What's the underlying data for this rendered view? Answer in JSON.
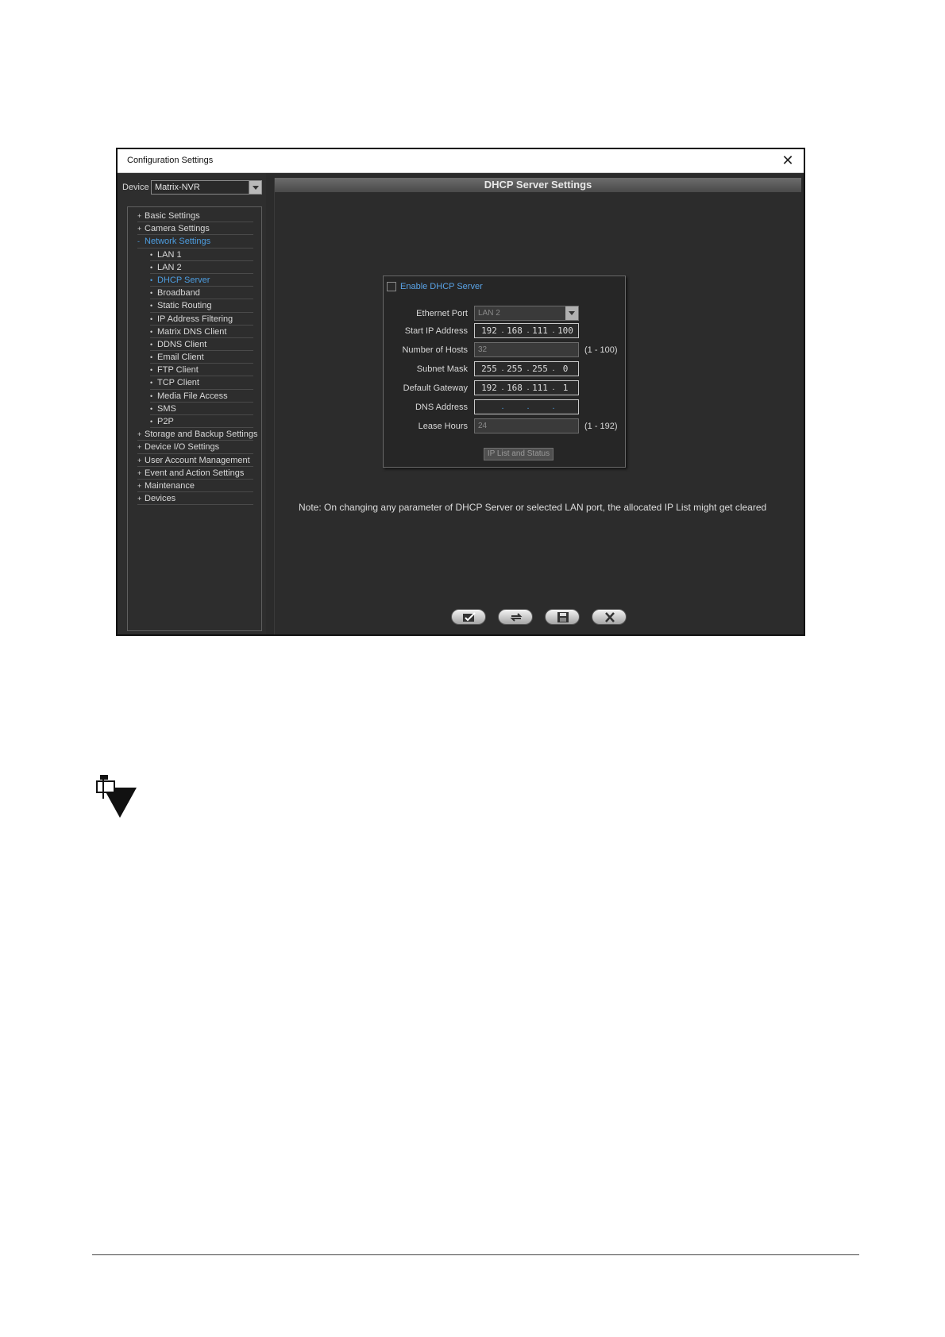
{
  "window": {
    "title": "Configuration Settings"
  },
  "device": {
    "label": "Device",
    "value": "Matrix-NVR"
  },
  "tree": {
    "items": [
      {
        "label": "Basic Settings",
        "mark": "+",
        "level": 0,
        "active": false
      },
      {
        "label": "Camera Settings",
        "mark": "+",
        "level": 0,
        "active": false
      },
      {
        "label": "Network Settings",
        "mark": "-",
        "level": 0,
        "active": true
      },
      {
        "label": "LAN 1",
        "mark": "•",
        "level": 1,
        "active": false
      },
      {
        "label": "LAN 2",
        "mark": "•",
        "level": 1,
        "active": false
      },
      {
        "label": "DHCP Server",
        "mark": "•",
        "level": 1,
        "active": true
      },
      {
        "label": "Broadband",
        "mark": "•",
        "level": 1,
        "active": false
      },
      {
        "label": "Static Routing",
        "mark": "•",
        "level": 1,
        "active": false
      },
      {
        "label": "IP Address Filtering",
        "mark": "•",
        "level": 1,
        "active": false
      },
      {
        "label": "Matrix DNS Client",
        "mark": "•",
        "level": 1,
        "active": false
      },
      {
        "label": "DDNS Client",
        "mark": "•",
        "level": 1,
        "active": false
      },
      {
        "label": "Email Client",
        "mark": "•",
        "level": 1,
        "active": false
      },
      {
        "label": "FTP Client",
        "mark": "•",
        "level": 1,
        "active": false
      },
      {
        "label": "TCP Client",
        "mark": "•",
        "level": 1,
        "active": false
      },
      {
        "label": "Media File Access",
        "mark": "•",
        "level": 1,
        "active": false
      },
      {
        "label": "SMS",
        "mark": "•",
        "level": 1,
        "active": false
      },
      {
        "label": "P2P",
        "mark": "•",
        "level": 1,
        "active": false
      },
      {
        "label": "Storage and Backup Settings",
        "mark": "+",
        "level": 0,
        "active": false
      },
      {
        "label": "Device I/O Settings",
        "mark": "+",
        "level": 0,
        "active": false
      },
      {
        "label": "User Account Management",
        "mark": "+",
        "level": 0,
        "active": false
      },
      {
        "label": "Event and Action Settings",
        "mark": "+",
        "level": 0,
        "active": false
      },
      {
        "label": "Maintenance",
        "mark": "+",
        "level": 0,
        "active": false
      },
      {
        "label": "Devices",
        "mark": "+",
        "level": 0,
        "active": false
      }
    ]
  },
  "panel": {
    "title": "DHCP Server Settings",
    "enable_label": "Enable DHCP Server",
    "ethernet_port": {
      "label": "Ethernet Port",
      "value": "LAN 2"
    },
    "start_ip": {
      "label": "Start IP Address",
      "octets": [
        "192",
        "168",
        "111",
        "100"
      ]
    },
    "hosts": {
      "label": "Number of Hosts",
      "value": "32",
      "range": "(1 - 100)"
    },
    "subnet": {
      "label": "Subnet Mask",
      "octets": [
        "255",
        "255",
        "255",
        "0"
      ]
    },
    "gateway": {
      "label": "Default Gateway",
      "octets": [
        "192",
        "168",
        "111",
        "1"
      ]
    },
    "dns": {
      "label": "DNS Address",
      "octets": [
        "",
        "",
        "",
        ""
      ]
    },
    "lease": {
      "label": "Lease Hours",
      "value": "24",
      "range": "(1 - 192)"
    },
    "iplist_button": "IP List and Status",
    "note": "Note: On changing any parameter of DHCP Server or selected LAN port, the allocated IP List might get cleared"
  },
  "actions": [
    {
      "name": "apply",
      "icon": "apply-icon"
    },
    {
      "name": "refresh",
      "icon": "refresh-icon"
    },
    {
      "name": "save",
      "icon": "save-icon"
    },
    {
      "name": "cancel",
      "icon": "cancel-icon"
    }
  ]
}
